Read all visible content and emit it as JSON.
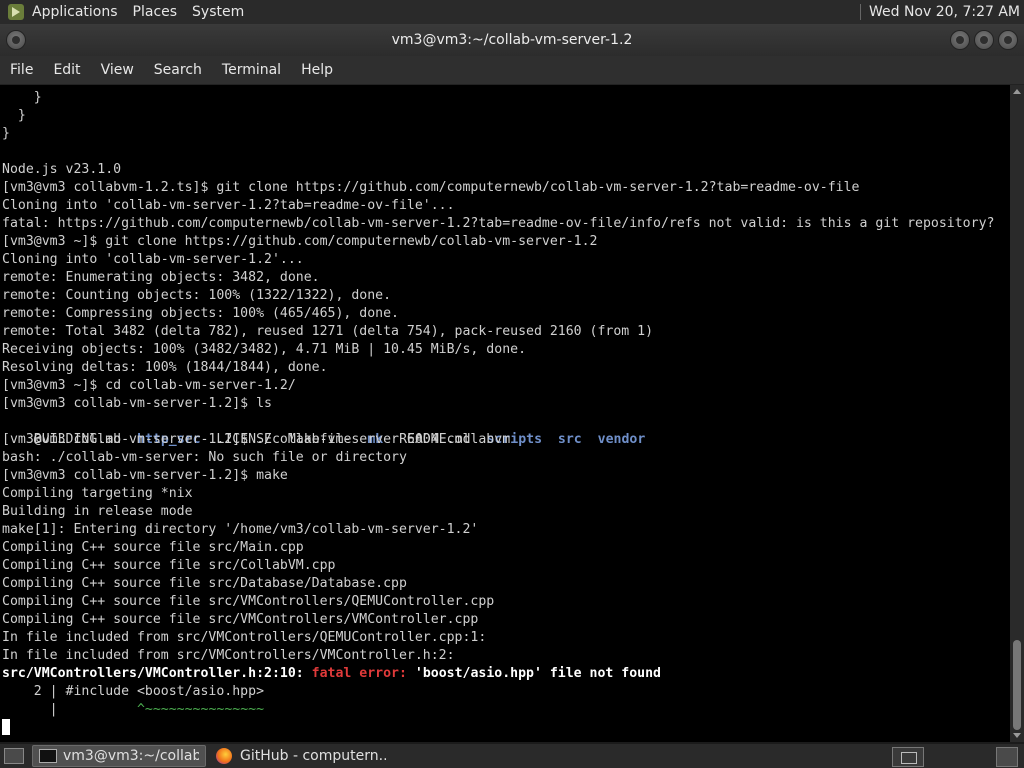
{
  "top_panel": {
    "menus": [
      "Applications",
      "Places",
      "System"
    ],
    "clock": "Wed Nov 20,  7:27 AM"
  },
  "window": {
    "title": "vm3@vm3:~/collab-vm-server-1.2"
  },
  "menubar": [
    "File",
    "Edit",
    "View",
    "Search",
    "Terminal",
    "Help"
  ],
  "terminal": {
    "lines": [
      "    }",
      "  }",
      "}",
      "",
      "Node.js v23.1.0",
      "[vm3@vm3 collabvm-1.2.ts]$ git clone https://github.com/computernewb/collab-vm-server-1.2?tab=readme-ov-file",
      "Cloning into 'collab-vm-server-1.2?tab=readme-ov-file'...",
      "fatal: https://github.com/computernewb/collab-vm-server-1.2?tab=readme-ov-file/info/refs not valid: is this a git repository?",
      "[vm3@vm3 ~]$ git clone https://github.com/computernewb/collab-vm-server-1.2",
      "Cloning into 'collab-vm-server-1.2'...",
      "remote: Enumerating objects: 3482, done.",
      "remote: Counting objects: 100% (1322/1322), done.",
      "remote: Compressing objects: 100% (465/465), done.",
      "remote: Total 3482 (delta 782), reused 1271 (delta 754), pack-reused 2160 (from 1)",
      "Receiving objects: 100% (3482/3482), 4.71 MiB | 10.45 MiB/s, done.",
      "Resolving deltas: 100% (1844/1844), done.",
      "[vm3@vm3 ~]$ cd collab-vm-server-1.2/",
      "[vm3@vm3 collab-vm-server-1.2]$ ls",
      null,
      "[vm3@vm3 collab-vm-server-1.2]$ ./collab-vm-server 6004 collabvm",
      "bash: ./collab-vm-server: No such file or directory",
      "[vm3@vm3 collab-vm-server-1.2]$ make",
      "Compiling targeting *nix",
      "Building in release mode",
      "make[1]: Entering directory '/home/vm3/collab-vm-server-1.2'",
      "Compiling C++ source file src/Main.cpp",
      "Compiling C++ source file src/CollabVM.cpp",
      "Compiling C++ source file src/Database/Database.cpp",
      "Compiling C++ source file src/VMControllers/QEMUController.cpp",
      "Compiling C++ source file src/VMControllers/VMController.cpp",
      "In file included from src/VMControllers/QEMUController.cpp:1:",
      "In file included from src/VMControllers/VMController.h:2:"
    ],
    "ls_output": {
      "files": [
        "BUILDING.md",
        "http_src",
        "LICENSE",
        "Makefile",
        "mk",
        "README.md",
        "scripts",
        "src",
        "vendor"
      ],
      "dirs": [
        "http_src",
        "mk",
        "scripts",
        "src",
        "vendor"
      ]
    },
    "error_line": {
      "location": "src/VMControllers/VMController.h:2:10: ",
      "kind": "fatal error: ",
      "message": "'boost/asio.hpp' file not found"
    },
    "source_line": "    2 | #include <boost/asio.hpp>",
    "caret_gutter": "      |          ",
    "caret": "^~~~~~~~~~~~~~~~"
  },
  "taskbar": {
    "tasks": [
      {
        "label": "vm3@vm3:~/collab...",
        "active": true
      },
      {
        "label": "GitHub - computern...",
        "active": false
      }
    ]
  }
}
